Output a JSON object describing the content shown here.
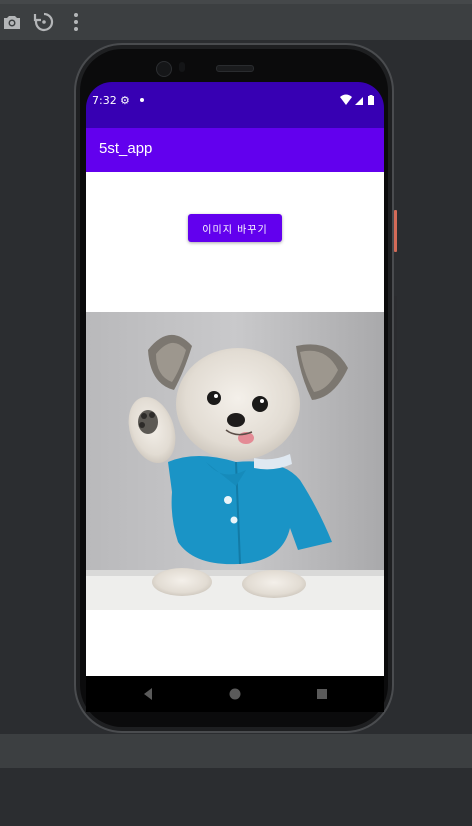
{
  "ide": {
    "toolbar": [
      "camera-icon",
      "rotate-icon",
      "more-vert-icon"
    ]
  },
  "status_bar": {
    "time": "7:32",
    "icons": [
      "gear-icon",
      "dot-icon",
      "wifi-icon",
      "signal-icon",
      "battery-icon"
    ],
    "color": "#3700b3"
  },
  "app": {
    "title": "5st_app",
    "bar_color": "#6200ee",
    "change_image_button": "이미지 바꾸기"
  },
  "image": {
    "subject": "dog-photo"
  },
  "nav_bar": {
    "buttons": [
      "back-icon",
      "home-icon",
      "recents-icon"
    ]
  }
}
